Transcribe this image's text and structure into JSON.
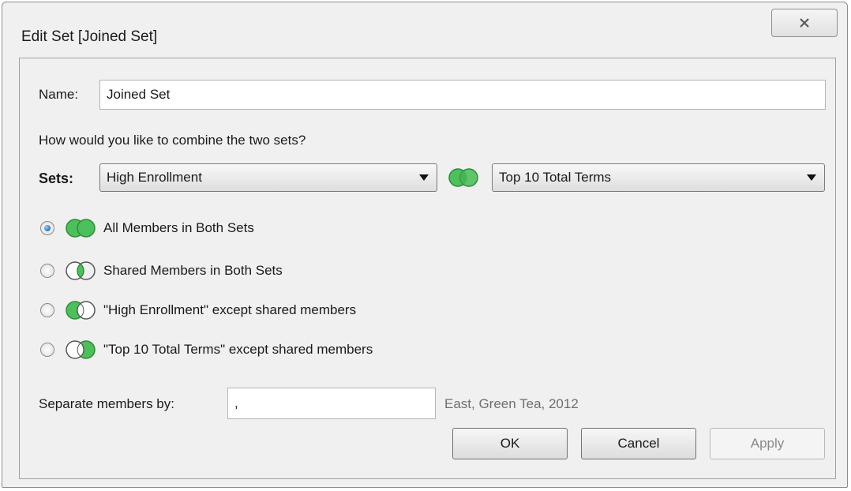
{
  "window": {
    "title": "Edit Set [Joined Set]"
  },
  "name_field": {
    "label": "Name:",
    "value": "Joined Set"
  },
  "question": "How would you like to combine the two sets?",
  "sets": {
    "label": "Sets:",
    "left_set": "High Enrollment",
    "right_set": "Top 10 Total Terms"
  },
  "options": [
    {
      "label": "All Members in Both Sets",
      "selected": true,
      "icon": "venn-union-icon"
    },
    {
      "label": "Shared Members in Both Sets",
      "selected": false,
      "icon": "venn-intersection-icon"
    },
    {
      "label": "\"High Enrollment\" except shared members",
      "selected": false,
      "icon": "venn-left-only-icon"
    },
    {
      "label": "\"Top 10 Total Terms\" except shared members",
      "selected": false,
      "icon": "venn-right-only-icon"
    }
  ],
  "separator": {
    "label": "Separate members by:",
    "value": ",",
    "example": "East, Green Tea, 2012"
  },
  "buttons": {
    "ok": "OK",
    "cancel": "Cancel",
    "apply": "Apply"
  },
  "colors": {
    "venn_green": "#3cb44b",
    "venn_green_dark": "#2e8b3a",
    "radio_selected": "#2a6fb5"
  }
}
